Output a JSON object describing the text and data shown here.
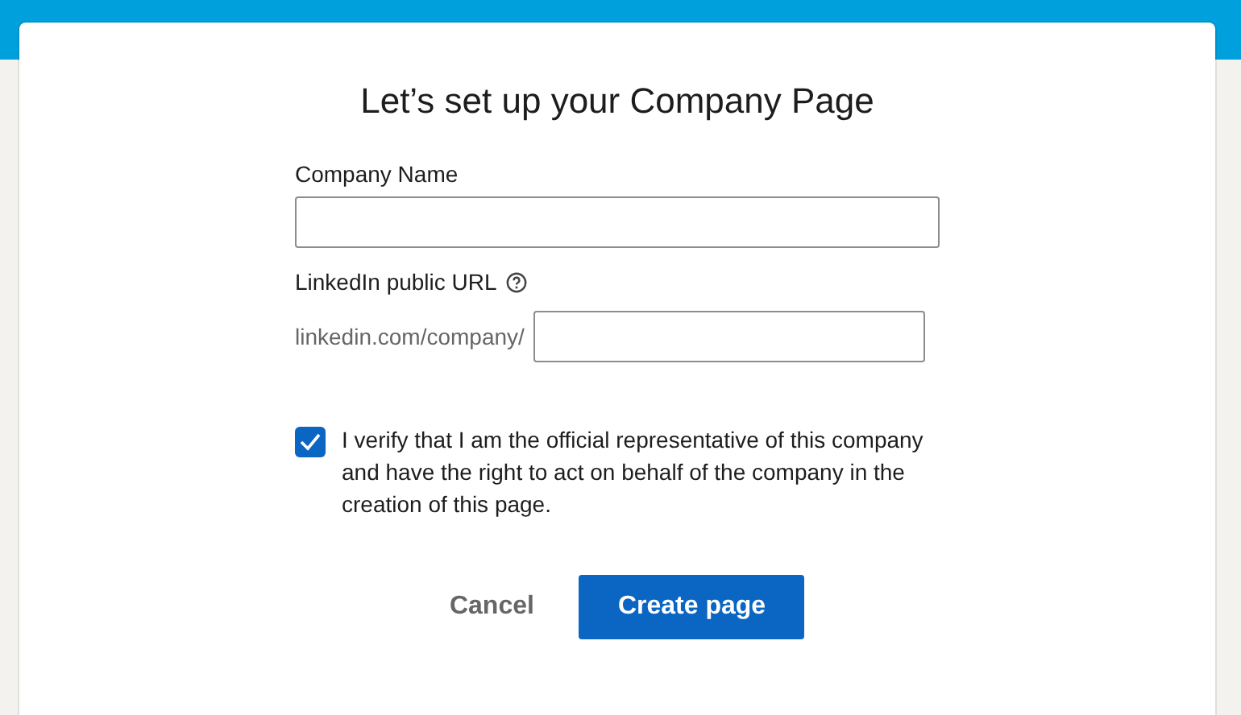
{
  "title": "Let’s set up your Company Page",
  "company_name": {
    "label": "Company Name"
  },
  "public_url": {
    "label": "LinkedIn public URL",
    "prefix": "linkedin.com/company/"
  },
  "verify": {
    "checked": true,
    "text": "I verify that I am the official representative of this company and have the right to act on behalf of the company in the creation of this page."
  },
  "buttons": [
    {
      "label": "Cancel",
      "kind": "secondary"
    },
    {
      "label": "Create page",
      "kind": "primary"
    }
  ]
}
